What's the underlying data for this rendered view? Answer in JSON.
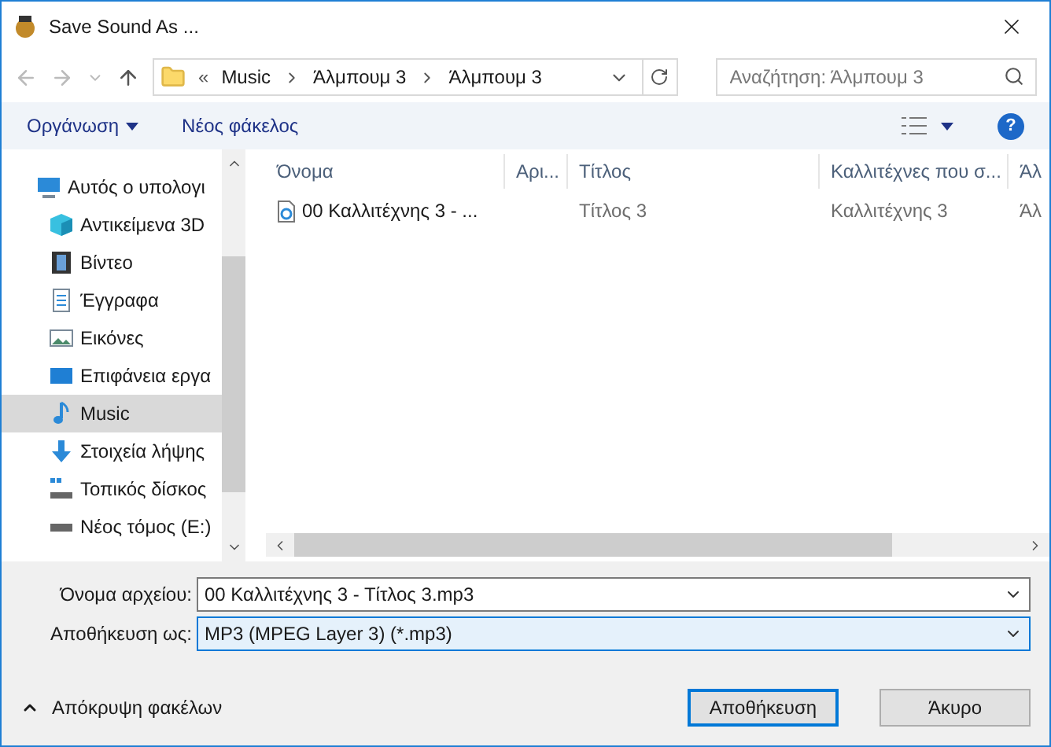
{
  "window": {
    "title": "Save Sound As ..."
  },
  "address": {
    "overflow": "«",
    "crumbs": [
      "Music",
      "Άλμπουμ 3",
      "Άλμπουμ 3"
    ]
  },
  "search": {
    "placeholder": "Αναζήτηση: Άλμπουμ 3"
  },
  "toolbar": {
    "organize": "Οργάνωση",
    "new_folder": "Νέος φάκελος"
  },
  "sidebar": {
    "items": [
      {
        "label": "Αυτός ο υπολογι",
        "kind": "pc",
        "selected": false
      },
      {
        "label": "Αντικείμενα 3D",
        "kind": "cube",
        "selected": false
      },
      {
        "label": "Βίντεο",
        "kind": "film",
        "selected": false
      },
      {
        "label": "Έγγραφα",
        "kind": "doc",
        "selected": false
      },
      {
        "label": "Εικόνες",
        "kind": "image",
        "selected": false
      },
      {
        "label": "Επιφάνεια εργα",
        "kind": "desktop",
        "selected": false
      },
      {
        "label": "Music",
        "kind": "music",
        "selected": true
      },
      {
        "label": "Στοιχεία λήψης",
        "kind": "download",
        "selected": false
      },
      {
        "label": "Τοπικός δίσκος",
        "kind": "drive",
        "selected": false
      },
      {
        "label": "Νέος τόμος (E:)",
        "kind": "drive2",
        "selected": false
      }
    ]
  },
  "table": {
    "columns": [
      "Όνομα",
      "Αρι...",
      "Τίτλος",
      "Καλλιτέχνες που σ...",
      "Άλ"
    ],
    "rows": [
      [
        "00 Καλλιτέχνης 3 - ...",
        "",
        "Τίτλος 3",
        "Καλλιτέχνης 3",
        "Άλ"
      ]
    ]
  },
  "filename": {
    "label": "Όνομα αρχείου:",
    "value": "00 Καλλιτέχνης 3 - Τίτλος 3.mp3"
  },
  "save_as": {
    "label": "Αποθήκευση ως:",
    "value": "MP3 (MPEG Layer 3) (*.mp3)"
  },
  "hide_folders": "Απόκρυψη φακέλων",
  "help": "?",
  "buttons": [
    "Αποθήκευση",
    "Άκυρο"
  ]
}
